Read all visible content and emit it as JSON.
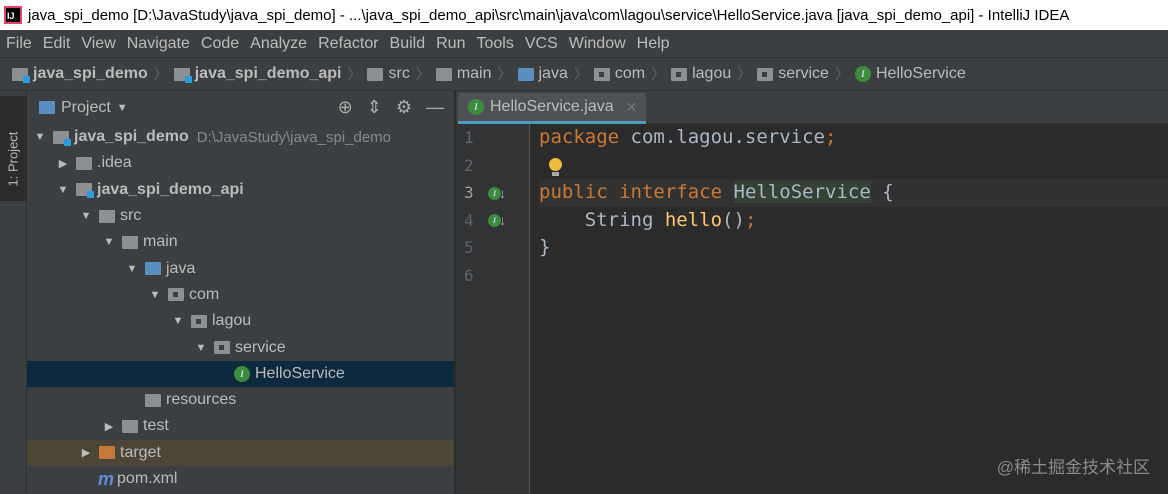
{
  "window": {
    "title": "java_spi_demo [D:\\JavaStudy\\java_spi_demo] - ...\\java_spi_demo_api\\src\\main\\java\\com\\lagou\\service\\HelloService.java [java_spi_demo_api] - IntelliJ IDEA"
  },
  "menu": [
    "File",
    "Edit",
    "View",
    "Navigate",
    "Code",
    "Analyze",
    "Refactor",
    "Build",
    "Run",
    "Tools",
    "VCS",
    "Window",
    "Help"
  ],
  "breadcrumbs": [
    "java_spi_demo",
    "java_spi_demo_api",
    "src",
    "main",
    "java",
    "com",
    "lagou",
    "service",
    "HelloService"
  ],
  "sidebar": {
    "strip_label": "1: Project",
    "panel_title": "Project"
  },
  "tree": [
    {
      "label": "java_spi_demo",
      "path": "D:\\JavaStudy\\java_spi_demo"
    },
    {
      "label": ".idea"
    },
    {
      "label": "java_spi_demo_api"
    },
    {
      "label": "src"
    },
    {
      "label": "main"
    },
    {
      "label": "java"
    },
    {
      "label": "com"
    },
    {
      "label": "lagou"
    },
    {
      "label": "service"
    },
    {
      "label": "HelloService"
    },
    {
      "label": "resources"
    },
    {
      "label": "test"
    },
    {
      "label": "target"
    },
    {
      "label": "pom.xml"
    }
  ],
  "editor": {
    "tab": "HelloService.java",
    "line_numbers": [
      "1",
      "2",
      "3",
      "4",
      "5",
      "6"
    ],
    "code": {
      "l1_kw": "package",
      "l1_rest": " com.lagou.service",
      "l1_semi": ";",
      "l3_kw1": "public",
      "l3_kw2": "interface",
      "l3_cls": "HelloService",
      "l3_rest": " {",
      "l4_type": "    String ",
      "l4_fn": "hello",
      "l4_paren": "()",
      "l4_semi": ";",
      "l5": "}"
    }
  },
  "watermark": "@稀土掘金技术社区"
}
